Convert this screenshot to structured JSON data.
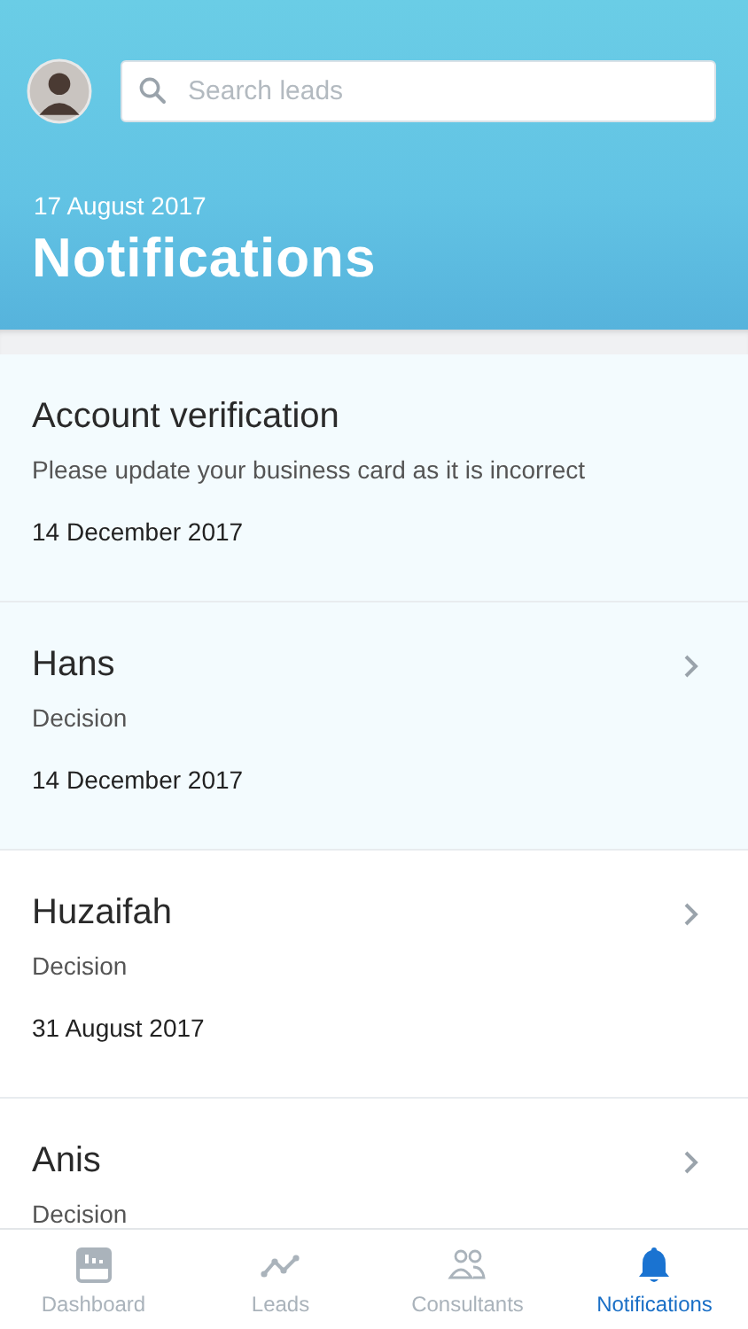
{
  "header": {
    "search": {
      "placeholder": "Search leads"
    },
    "date": "17 August 2017",
    "title": "Notifications"
  },
  "notifications": [
    {
      "title": "Account verification",
      "subtitle": "Please update your business card as it is incorrect",
      "date": "14 December 2017",
      "unread": true,
      "has_arrow": false
    },
    {
      "title": "Hans",
      "subtitle": "Decision",
      "date": "14 December 2017",
      "unread": true,
      "has_arrow": true
    },
    {
      "title": "Huzaifah",
      "subtitle": "Decision",
      "date": "31 August 2017",
      "unread": false,
      "has_arrow": true
    },
    {
      "title": "Anis",
      "subtitle": "Decision",
      "unread": false,
      "has_arrow": true
    }
  ],
  "tabs": [
    {
      "kind": "dashboard",
      "label": "Dashboard",
      "selected": false
    },
    {
      "kind": "leads",
      "label": "Leads",
      "selected": false
    },
    {
      "kind": "consultants",
      "label": "Consultants",
      "selected": false
    },
    {
      "kind": "notifications",
      "label": "Notifications",
      "selected": true
    }
  ]
}
